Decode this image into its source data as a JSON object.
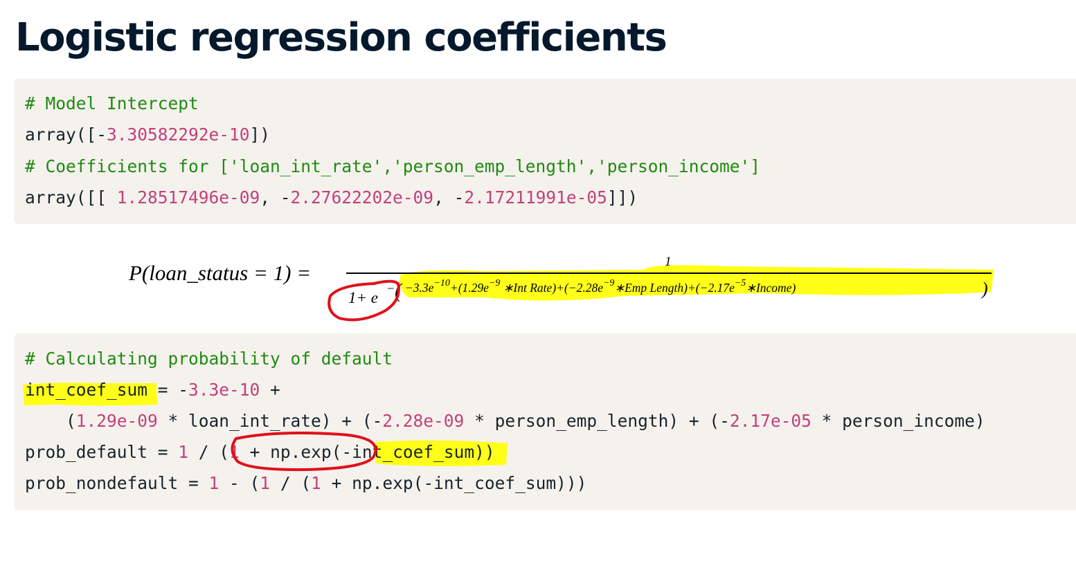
{
  "title": "Logistic regression coefficients",
  "code1": {
    "line1": "# Model Intercept",
    "line2": {
      "a": "array([-",
      "b": "3.30582292e-10",
      "c": "])"
    },
    "line3": "# Coefficients for ['loan_int_rate','person_emp_length','person_income']",
    "line4": {
      "a": "array([[ ",
      "b": "1.28517496e-09",
      "c": ", -",
      "d": "2.27622202e-09",
      "e": ", -",
      "f": "2.17211991e-05",
      "g": "]])"
    }
  },
  "formula": {
    "lhs": "P(loan_status = 1) =",
    "numerator": "1",
    "den_base": "1+ e",
    "minus": "−",
    "open": "(",
    "t1": "−3.3e",
    "t1_exp": "−10",
    "plus1": "+(1.29e",
    "t2_exp": "−9",
    "t2": " ∗Int Rate)+(−2.28e",
    "t3_exp": "−9",
    "t3": "∗Emp Length)+(−2.17e",
    "t4_exp": "−5",
    "t4": "∗Income)",
    "close": ")"
  },
  "code2": {
    "line1": "# Calculating probability of default",
    "line2": {
      "a": "int_coef_sum",
      "b": " = -",
      "c": "3.3e-10",
      "d": " +"
    },
    "line3": {
      "a": "    (",
      "b": "1.29e-09",
      "c": " * loan_int_rate) + (-",
      "d": "2.28e-09",
      "e": " * person_emp_length) + (-",
      "f": "2.17e-05",
      "g": " * person_income)"
    },
    "line4": {
      "a": "prob_default = ",
      "b": "1",
      "c": " / (",
      "d": "1",
      "e": " + np.exp(-",
      "f": "int_coef_sum",
      "g": "))"
    },
    "line5": {
      "a": "prob_nondefault = ",
      "b": "1",
      "c": " - (",
      "d": "1",
      "e": " / (",
      "f": "1",
      "g": " + np.exp(-int_coef_sum)))"
    }
  },
  "colors": {
    "title": "#05192d",
    "code_bg": "#f5f2ed",
    "comment": "#1f8a10",
    "number": "#c3407a",
    "highlight": "#ffff18",
    "annotation_circle": "#e0101a"
  }
}
